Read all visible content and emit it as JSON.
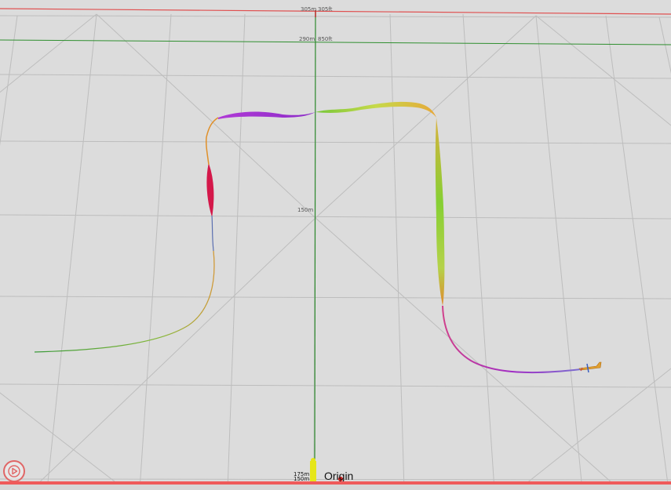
{
  "scale": {
    "top_distance": "305m",
    "top_distance_alt": "305ft",
    "mid_distance": "290m",
    "mid_distance_alt": "850ft",
    "center_distance": "150m"
  },
  "origin": {
    "label": "Origin",
    "altitude_top": "175m",
    "altitude_bottom": "150m"
  },
  "colors": {
    "background": "#dcdcdc",
    "grid": "#b8b8b8",
    "north_axis": "#2e8b2e",
    "horizon_red": "#e05050",
    "horizon_green": "#2f8f2f",
    "accent_red": "#ef5a5a"
  },
  "controls": {
    "play_icon": "play-icon"
  }
}
